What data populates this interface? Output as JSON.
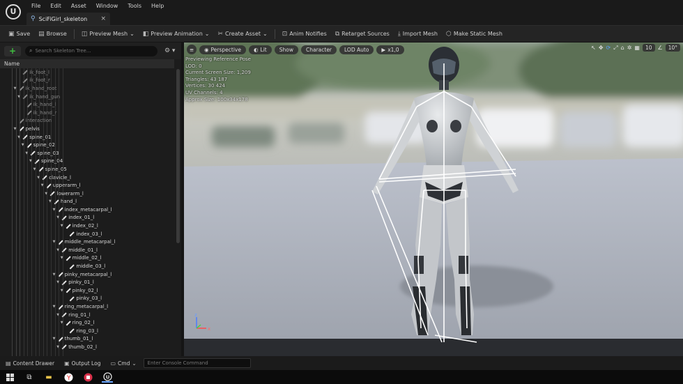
{
  "menu": [
    "File",
    "Edit",
    "Asset",
    "Window",
    "Tools",
    "Help"
  ],
  "tab": {
    "label": "SciFiGirl_skeleton",
    "close": "×"
  },
  "toolbar": [
    {
      "label": "Save",
      "icon": "save-icon"
    },
    {
      "label": "Browse",
      "icon": "folder-icon"
    },
    {
      "label": "Preview Mesh",
      "icon": "mesh-icon",
      "dropdown": true
    },
    {
      "label": "Preview Animation",
      "icon": "animation-icon",
      "dropdown": true
    },
    {
      "label": "Create Asset",
      "icon": "create-asset-icon",
      "dropdown": true
    },
    {
      "label": "Anim Notifies",
      "icon": "notify-icon"
    },
    {
      "label": "Retarget Sources",
      "icon": "retarget-icon"
    },
    {
      "label": "Import Mesh",
      "icon": "import-icon"
    },
    {
      "label": "Make Static Mesh",
      "icon": "static-mesh-icon"
    }
  ],
  "tree": {
    "add_label": "+",
    "search_placeholder": "Search Skeleton Tree...",
    "column_name": "Name",
    "rows": [
      {
        "label": "ik_foot_l",
        "depth": 2,
        "dim": true,
        "expand": false
      },
      {
        "label": "ik_foot_r",
        "depth": 2,
        "dim": true,
        "expand": false
      },
      {
        "label": "ik_hand_root",
        "depth": 1,
        "dim": true,
        "expand": true
      },
      {
        "label": "ik_hand_gun",
        "depth": 2,
        "dim": true,
        "expand": true
      },
      {
        "label": "ik_hand_l",
        "depth": 3,
        "dim": true,
        "expand": false
      },
      {
        "label": "ik_hand_r",
        "depth": 3,
        "dim": true,
        "expand": false
      },
      {
        "label": "interaction",
        "depth": 1,
        "dim": true,
        "expand": false
      },
      {
        "label": "pelvis",
        "depth": 1,
        "dim": false,
        "expand": true
      },
      {
        "label": "spine_01",
        "depth": 2,
        "dim": false,
        "expand": true
      },
      {
        "label": "spine_02",
        "depth": 3,
        "dim": false,
        "expand": true
      },
      {
        "label": "spine_03",
        "depth": 4,
        "dim": false,
        "expand": true
      },
      {
        "label": "spine_04",
        "depth": 5,
        "dim": false,
        "expand": true
      },
      {
        "label": "spine_05",
        "depth": 6,
        "dim": false,
        "expand": true
      },
      {
        "label": "clavicle_l",
        "depth": 7,
        "dim": false,
        "expand": true
      },
      {
        "label": "upperarm_l",
        "depth": 8,
        "dim": false,
        "expand": true
      },
      {
        "label": "lowerarm_l",
        "depth": 9,
        "dim": false,
        "expand": true
      },
      {
        "label": "hand_l",
        "depth": 10,
        "dim": false,
        "expand": true
      },
      {
        "label": "index_metacarpal_l",
        "depth": 11,
        "dim": false,
        "expand": true
      },
      {
        "label": "index_01_l",
        "depth": 12,
        "dim": false,
        "expand": true
      },
      {
        "label": "index_02_l",
        "depth": 13,
        "dim": false,
        "expand": true
      },
      {
        "label": "index_03_l",
        "depth": 14,
        "dim": false,
        "expand": false
      },
      {
        "label": "middle_metacarpal_l",
        "depth": 11,
        "dim": false,
        "expand": true
      },
      {
        "label": "middle_01_l",
        "depth": 12,
        "dim": false,
        "expand": true
      },
      {
        "label": "middle_02_l",
        "depth": 13,
        "dim": false,
        "expand": true
      },
      {
        "label": "middle_03_l",
        "depth": 14,
        "dim": false,
        "expand": false
      },
      {
        "label": "pinky_metacarpal_l",
        "depth": 11,
        "dim": false,
        "expand": true
      },
      {
        "label": "pinky_01_l",
        "depth": 12,
        "dim": false,
        "expand": true
      },
      {
        "label": "pinky_02_l",
        "depth": 13,
        "dim": false,
        "expand": true
      },
      {
        "label": "pinky_03_l",
        "depth": 14,
        "dim": false,
        "expand": false
      },
      {
        "label": "ring_metacarpal_l",
        "depth": 11,
        "dim": false,
        "expand": true
      },
      {
        "label": "ring_01_l",
        "depth": 12,
        "dim": false,
        "expand": true
      },
      {
        "label": "ring_02_l",
        "depth": 13,
        "dim": false,
        "expand": true
      },
      {
        "label": "ring_03_l",
        "depth": 14,
        "dim": false,
        "expand": false
      },
      {
        "label": "thumb_01_l",
        "depth": 11,
        "dim": false,
        "expand": true
      },
      {
        "label": "thumb_02_l",
        "depth": 12,
        "dim": false,
        "expand": true
      }
    ]
  },
  "viewport": {
    "buttons": [
      "Perspective",
      "Lit",
      "Show",
      "Character",
      "LOD Auto",
      "x1,0"
    ],
    "stats": [
      "Previewing Reference Pose",
      "LOD: 0",
      "Current Screen Size: 1,209",
      "Triangles: 43 187",
      "Vertices: 30 424",
      "UV Channels: 4",
      "Approx Size: 100x34x178"
    ],
    "grid_value": "10",
    "angle_value": "10°",
    "axis_z": "z",
    "axis_x": "x"
  },
  "bottom": {
    "content_drawer": "Content Drawer",
    "output_log": "Output Log",
    "cmd": "Cmd",
    "console_placeholder": "Enter Console Command"
  }
}
